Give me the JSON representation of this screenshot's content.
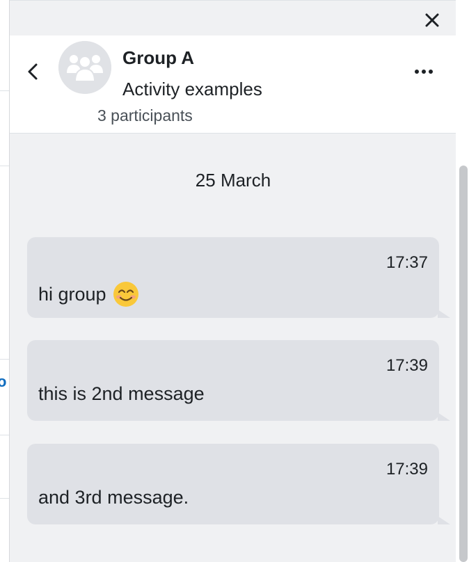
{
  "conversation": {
    "title": "Group A",
    "subtitle": "Activity examples",
    "participants": "3 participants"
  },
  "date_separator": "25 March",
  "messages": [
    {
      "time": "17:37",
      "text": "hi group",
      "emoji": "smiling-face-emoji"
    },
    {
      "time": "17:39",
      "text": "this is 2nd message"
    },
    {
      "time": "17:39",
      "text": "and 3rd message."
    }
  ],
  "background_page": {
    "link_fragment": "o"
  },
  "icons": {
    "close": "close-icon",
    "back": "chevron-left-icon",
    "menu": "more-horizontal-icon",
    "avatar": "group-avatar-icon"
  },
  "colors": {
    "drawer_bg": "#f0f1f3",
    "bubble_bg": "#dfe1e6",
    "link": "#0f6cbf"
  }
}
